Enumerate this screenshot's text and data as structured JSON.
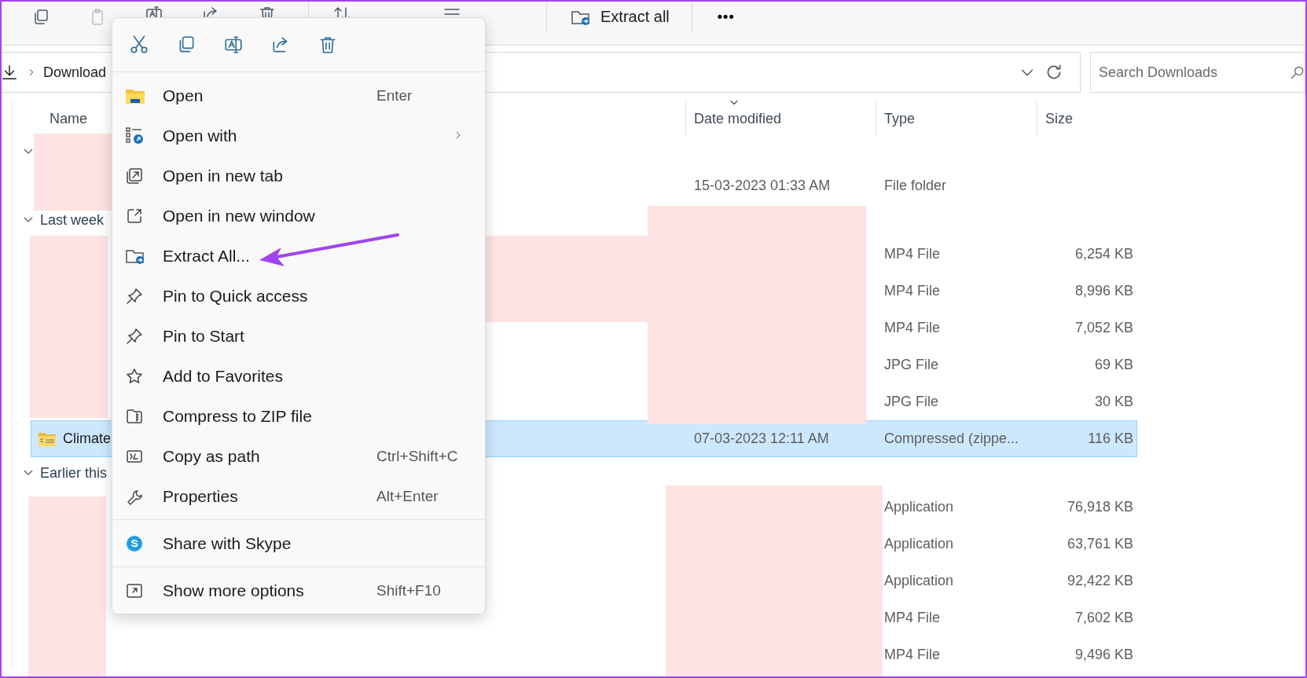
{
  "toolbar": {
    "icon_buttons": [
      {
        "disabled": false
      },
      {
        "disabled": true
      },
      {
        "disabled": false
      },
      {
        "disabled": false
      },
      {
        "disabled": false
      },
      {
        "disabled": false
      },
      {
        "disabled": false
      }
    ],
    "extract_all": "Extract all",
    "more": "•••"
  },
  "address_bar": {
    "crumb": "Download"
  },
  "search": {
    "placeholder": "Search Downloads"
  },
  "columns": [
    {
      "label": "Name",
      "sorted": false
    },
    {
      "label": "Date modified",
      "sorted": true
    },
    {
      "label": "Type",
      "sorted": false
    },
    {
      "label": "Size",
      "sorted": false
    }
  ],
  "rows": [
    {
      "kind": "group",
      "expanded": true
    },
    {
      "kind": "file",
      "date": "15-03-2023 01:33 AM",
      "type": "File folder",
      "selected": false
    },
    {
      "kind": "group",
      "expanded": true,
      "label": "Last week"
    },
    {
      "kind": "file",
      "type": "MP4 File",
      "size": "6,254 KB",
      "selected": false
    },
    {
      "kind": "file",
      "type": "MP4 File",
      "size": "8,996 KB",
      "selected": false
    },
    {
      "kind": "file",
      "type": "MP4 File",
      "size": "7,052 KB",
      "selected": false
    },
    {
      "kind": "file",
      "type": "JPG File",
      "size": "69 KB",
      "selected": false
    },
    {
      "kind": "file",
      "type": "JPG File",
      "size": "30 KB",
      "selected": false
    },
    {
      "kind": "file",
      "name": "Climate",
      "date": "07-03-2023 12:11 AM",
      "type": "Compressed (zippe...",
      "size": "116 KB",
      "selected": true
    },
    {
      "kind": "group",
      "expanded": true,
      "label": "Earlier this"
    },
    {
      "kind": "file",
      "type": "Application",
      "size": "76,918 KB",
      "selected": false
    },
    {
      "kind": "file",
      "type": "Application",
      "size": "63,761 KB",
      "selected": false
    },
    {
      "kind": "file",
      "type": "Application",
      "size": "92,422 KB",
      "selected": false
    },
    {
      "kind": "file",
      "type": "MP4 File",
      "size": "7,602 KB",
      "selected": false
    },
    {
      "kind": "file",
      "type": "MP4 File",
      "size": "9,496 KB",
      "selected": false
    }
  ],
  "context_menu": {
    "sections": [
      [
        {
          "label": "Open",
          "shortcut": "Enter",
          "submenu": false
        },
        {
          "label": "Open with",
          "submenu": true
        },
        {
          "label": "Open in new tab",
          "submenu": false
        },
        {
          "label": "Open in new window",
          "submenu": false
        },
        {
          "label": "Extract All...",
          "submenu": false
        },
        {
          "label": "Pin to Quick access",
          "submenu": false
        },
        {
          "label": "Pin to Start",
          "submenu": false
        },
        {
          "label": "Add to Favorites",
          "submenu": false
        },
        {
          "label": "Compress to ZIP file",
          "submenu": false
        },
        {
          "label": "Copy as path",
          "shortcut": "Ctrl+Shift+C",
          "submenu": false
        },
        {
          "label": "Properties",
          "shortcut": "Alt+Enter",
          "submenu": false
        }
      ],
      [
        {
          "label": "Share with Skype",
          "submenu": false
        }
      ],
      [
        {
          "label": "Show more options",
          "shortcut": "Shift+F10",
          "submenu": false
        }
      ]
    ]
  }
}
